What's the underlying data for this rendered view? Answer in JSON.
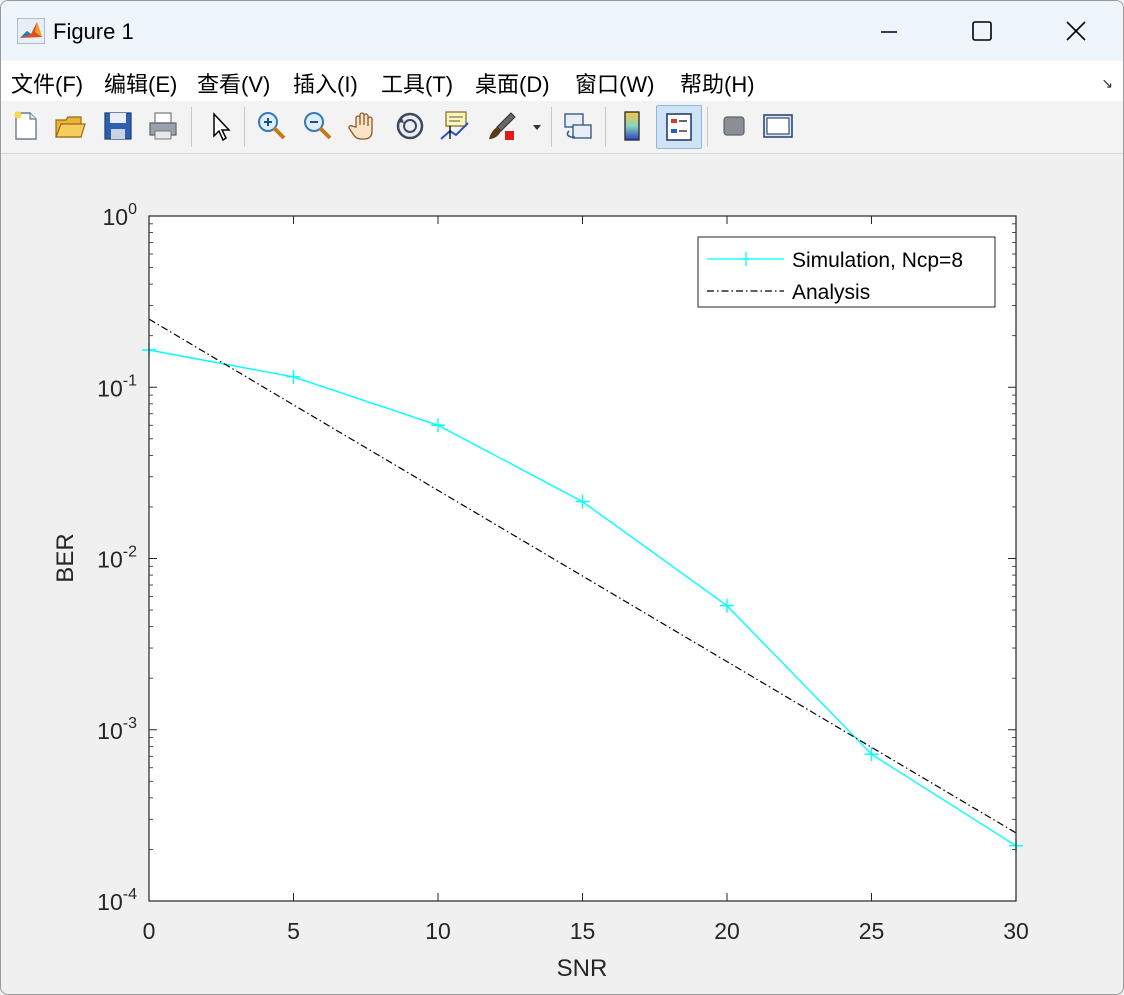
{
  "window": {
    "title": "Figure 1"
  },
  "menu": [
    {
      "label": "文件(F)"
    },
    {
      "label": "编辑(E)"
    },
    {
      "label": "查看(V)"
    },
    {
      "label": "插入(I)"
    },
    {
      "label": "工具(T)"
    },
    {
      "label": "桌面(D)"
    },
    {
      "label": "窗口(W)"
    },
    {
      "label": "帮助(H)"
    }
  ],
  "toolbar": [
    {
      "icon": "new-figure-icon"
    },
    {
      "icon": "open-file-icon"
    },
    {
      "icon": "save-icon"
    },
    {
      "icon": "print-icon"
    },
    {
      "icon": "pointer-icon"
    },
    {
      "icon": "zoom-in-icon"
    },
    {
      "icon": "zoom-out-icon"
    },
    {
      "icon": "pan-icon"
    },
    {
      "icon": "rotate-3d-icon"
    },
    {
      "icon": "data-cursor-icon"
    },
    {
      "icon": "brush-icon"
    },
    {
      "icon": "link-plot-icon"
    },
    {
      "icon": "colorbar-icon"
    },
    {
      "icon": "legend-icon"
    },
    {
      "icon": "hide-plot-tools-icon"
    },
    {
      "icon": "show-plot-tools-icon"
    }
  ],
  "colors": {
    "simulation": "#00ffff",
    "analysis": "#000000"
  },
  "chart_data": {
    "type": "line",
    "title": "",
    "xlabel": "SNR",
    "ylabel": "BER",
    "xlim": [
      0,
      30
    ],
    "ylim": [
      0.0001,
      1
    ],
    "yscale": "log",
    "grid": false,
    "xticks": [
      0,
      5,
      10,
      15,
      20,
      25,
      30
    ],
    "xtick_labels": [
      "0",
      "5",
      "10",
      "15",
      "20",
      "25",
      "30"
    ],
    "yticks": [
      1,
      0.1,
      0.01,
      0.001,
      0.0001
    ],
    "ytick_labels": [
      {
        "base": "10",
        "exp": "0"
      },
      {
        "base": "10",
        "exp": "-1"
      },
      {
        "base": "10",
        "exp": "-2"
      },
      {
        "base": "10",
        "exp": "-3"
      },
      {
        "base": "10",
        "exp": "-4"
      }
    ],
    "legend_position": "top-right",
    "series": [
      {
        "name": "Simulation, Ncp=8",
        "style": "solid",
        "marker": "+",
        "x": [
          0,
          5,
          10,
          15,
          20,
          25,
          30
        ],
        "y": [
          0.165,
          0.115,
          0.06,
          0.0215,
          0.0053,
          0.00072,
          0.00021
        ]
      },
      {
        "name": "Analysis",
        "style": "dashdot",
        "marker": "none",
        "x": [
          0,
          5,
          10,
          15,
          20,
          25,
          30
        ],
        "y": [
          0.25,
          0.0789,
          0.025,
          0.0079,
          0.0025,
          0.00079,
          0.00025
        ]
      }
    ]
  }
}
